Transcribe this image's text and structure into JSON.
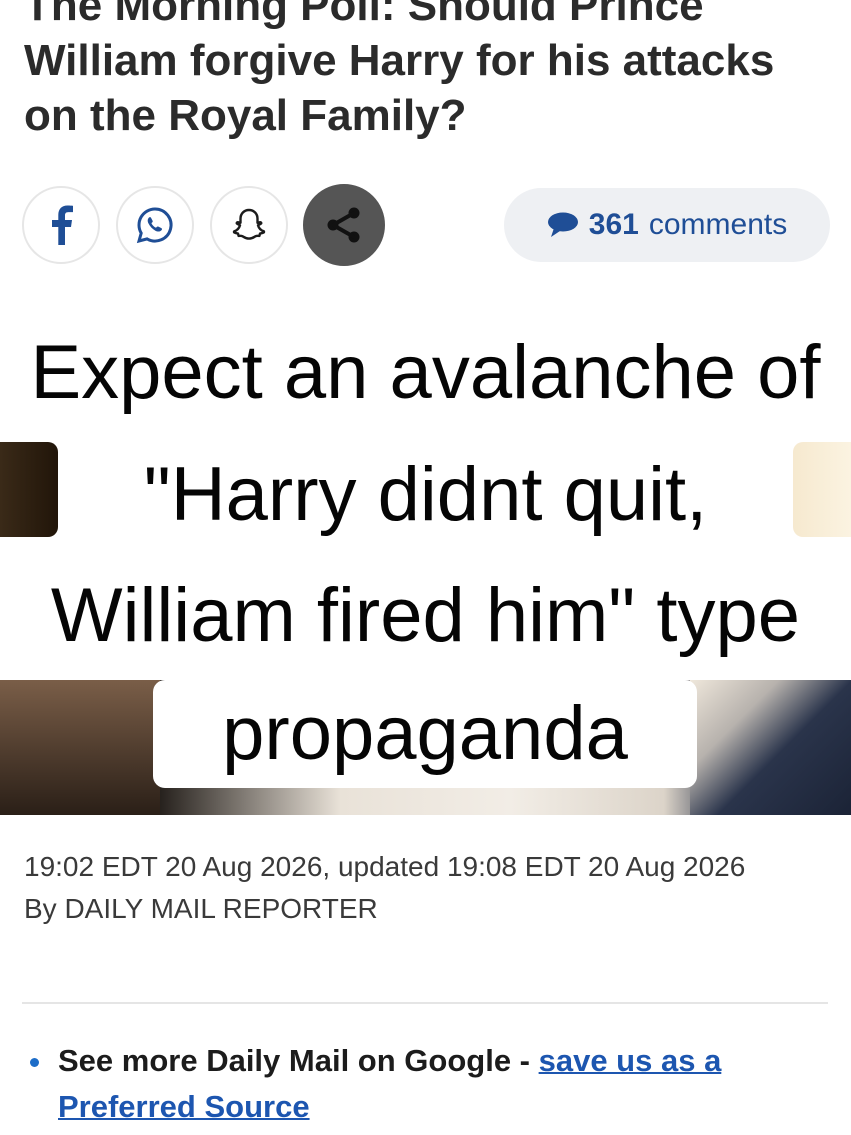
{
  "article": {
    "headline": "The Morning Poll: Should Prince William forgive Harry for his attacks on the Royal Family?"
  },
  "share": {
    "facebook_icon": "facebook-icon",
    "whatsapp_icon": "whatsapp-icon",
    "snapchat_icon": "snapchat-icon",
    "share_icon": "share-icon",
    "comment_count": "361",
    "comment_word": "comments",
    "colors": {
      "comments_blue": "#1f4e96",
      "share_grey": "#555555"
    }
  },
  "overlay_caption": {
    "line1": "Expect an avalanche of",
    "line2": "\"Harry didnt quit,",
    "line3": "William fired him\" type",
    "line4": "propaganda"
  },
  "meta": {
    "dates": "19:02 EDT 20 Aug 2026, updated 19:08 EDT 20 Aug 2026",
    "byline": "By DAILY MAIL REPORTER"
  },
  "promo": {
    "text": "See more Daily Mail on Google - ",
    "link": "save us as a Preferred Source"
  }
}
